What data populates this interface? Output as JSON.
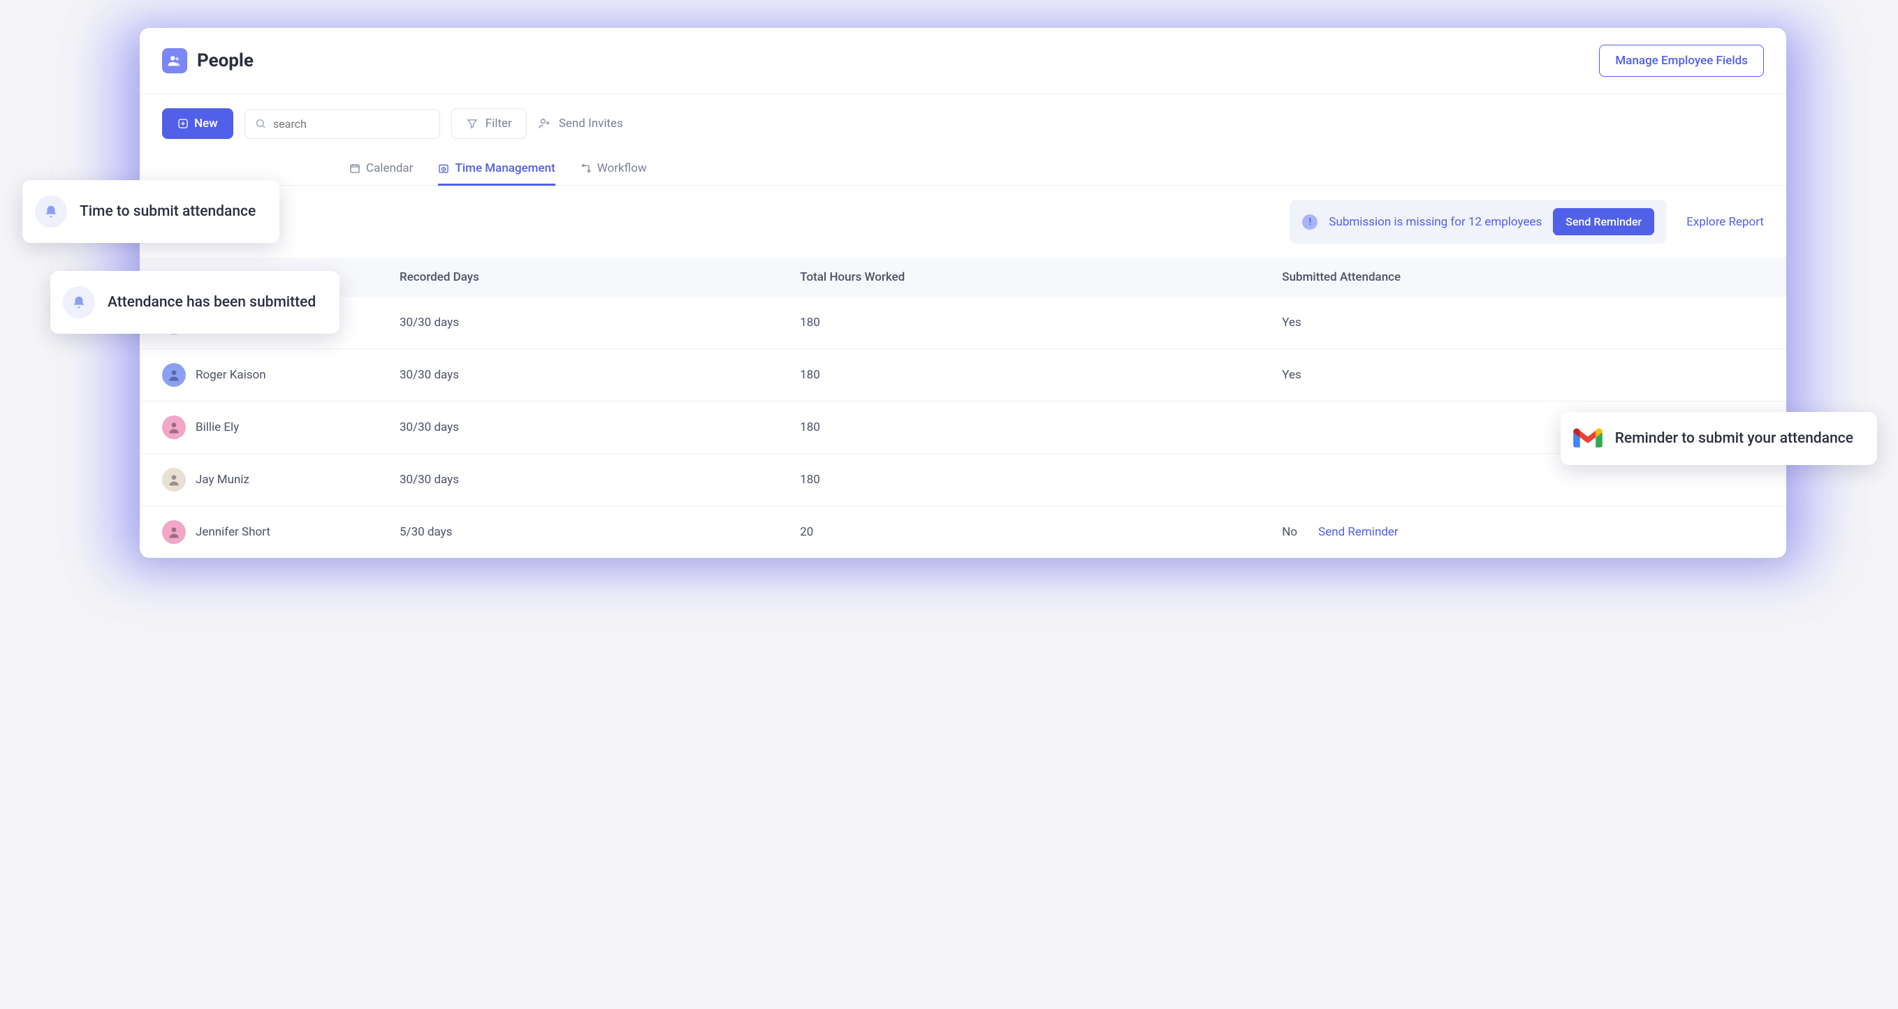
{
  "page": {
    "title": "People"
  },
  "header": {
    "manage_fields": "Manage Employee Fields"
  },
  "toolbar": {
    "new_label": "New",
    "search_placeholder": "search",
    "filter_label": "Filter",
    "send_invites_label": "Send Invites"
  },
  "tabs": [
    {
      "label": "Calendar",
      "active": false
    },
    {
      "label": "Time Management",
      "active": true
    },
    {
      "label": "Workflow",
      "active": false
    }
  ],
  "alert": {
    "message": "Submission is missing for 12 employees",
    "button": "Send Reminder",
    "explore": "Explore Report"
  },
  "table": {
    "columns": [
      "Recorded Days",
      "Total Hours Worked",
      "Submitted Attendance"
    ],
    "rows": [
      {
        "name": "",
        "recorded": "30/30 days",
        "hours": "180",
        "submitted": "Yes",
        "avatar_bg": "#f2a6c8"
      },
      {
        "name": "Roger Kaison",
        "recorded": "30/30 days",
        "hours": "180",
        "submitted": "Yes",
        "avatar_bg": "#8b9ff5"
      },
      {
        "name": "Billie Ely",
        "recorded": "30/30 days",
        "hours": "180",
        "submitted": "",
        "avatar_bg": "#f2a6c8"
      },
      {
        "name": "Jay Muniz",
        "recorded": "30/30 days",
        "hours": "180",
        "submitted": "",
        "avatar_bg": "#e8e0d4"
      },
      {
        "name": "Jennifer Short",
        "recorded": "5/30 days",
        "hours": "20",
        "submitted": "No",
        "avatar_bg": "#f2a6c8",
        "reminder": "Send Reminder"
      }
    ]
  },
  "toasts": {
    "t1": "Time to submit attendance",
    "t2": "Attendance has been submitted",
    "t3": "Reminder to submit your attendance"
  }
}
